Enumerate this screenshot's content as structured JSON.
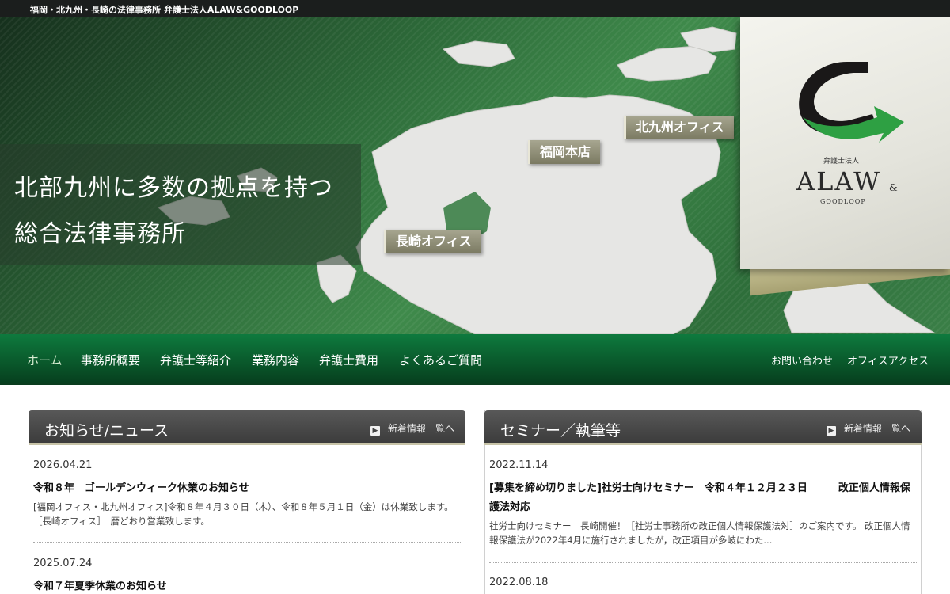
{
  "topbar": {
    "text": "福岡・北九州・長崎の法律事務所 弁護士法人ALAW&GOODLOOP"
  },
  "hero": {
    "caption_line1": "北部九州に多数の拠点を持つ",
    "caption_line2": "総合法律事務所",
    "offices": {
      "kitakyushu": "北九州オフィス",
      "fukuoka": "福岡本店",
      "nagasaki": "長崎オフィス"
    },
    "logo": {
      "sub": "弁護士法人",
      "name": "ALAW",
      "amp": "&",
      "goodloop": "GOODLOOP"
    }
  },
  "nav": {
    "items": [
      "ホーム",
      "事務所概要",
      "弁護士等紹介",
      "業務内容",
      "弁護士費用",
      "よくあるご質問"
    ],
    "sub": [
      "お問い合わせ",
      "オフィスアクセス"
    ]
  },
  "news": {
    "title": "お知らせ/ニュース",
    "link": "新着情報一覧へ",
    "entries": [
      {
        "date": "2026.04.21",
        "title": "令和８年　ゴールデンウィーク休業のお知らせ",
        "body": "[福岡オフィス・北九州オフィス]令和８年４月３０日（木）、令和８年５月１日（金）は休業致します。［長崎オフィス］　暦どおり営業致します。"
      },
      {
        "date": "2025.07.24",
        "title": "令和７年夏季休業のお知らせ"
      }
    ]
  },
  "seminar": {
    "title": "セミナー／執筆等",
    "link": "新着情報一覧へ",
    "entries": [
      {
        "date": "2022.11.14",
        "title": "[募集を締め切りました]社労士向けセミナー　令和４年１２月２３日　　　改正個人情報保護法対応",
        "body": "社労士向けセミナー　長崎開催！［社労士事務所の改正個人情報保護法対］のご案内です。 改正個人情報保護法が2022年4月に施行されましたが，改正項目が多岐にわた..."
      },
      {
        "date": "2022.08.18"
      }
    ]
  },
  "colors": {
    "nav_green": "#0a5a2c",
    "hero_green": "#3f8a4b",
    "panel_header": "#4a4a4a",
    "tag_olive": "#8f8e76"
  }
}
